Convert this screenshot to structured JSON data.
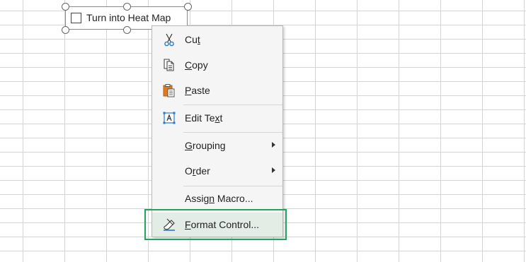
{
  "control": {
    "label": "Turn into Heat Map"
  },
  "menu": {
    "items": [
      {
        "label_before": "Cu",
        "accel": "t",
        "label_after": "",
        "icon": "scissors-icon"
      },
      {
        "label_before": "",
        "accel": "C",
        "label_after": "opy",
        "icon": "copy-icon"
      },
      {
        "label_before": "",
        "accel": "P",
        "label_after": "aste",
        "icon": "clipboard-paste-icon"
      },
      {
        "label_before": "Edit Te",
        "accel": "x",
        "label_after": "t",
        "icon": "edit-text-icon"
      },
      {
        "label_before": "",
        "accel": "G",
        "label_after": "rouping",
        "icon": "",
        "submenu": true
      },
      {
        "label_before": "O",
        "accel": "r",
        "label_after": "der",
        "icon": "",
        "submenu": true
      },
      {
        "label_before": "Assig",
        "accel": "n",
        "label_after": " Macro...",
        "icon": ""
      },
      {
        "label_before": "",
        "accel": "F",
        "label_after": "ormat Control...",
        "icon": "format-control-icon",
        "highlighted": true
      }
    ]
  },
  "colors": {
    "highlight_border": "#22a35b",
    "menu_background": "#f5f5f5",
    "icon_blue": "#2b78c5",
    "icon_orange": "#e07a1f"
  }
}
